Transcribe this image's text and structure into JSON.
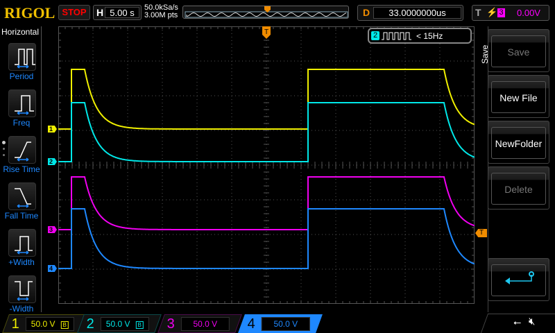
{
  "header": {
    "logo": "RIGOL",
    "run_state": "STOP",
    "timebase_label": "H",
    "timebase": "5.00 s",
    "sample_rate": "50.0kSa/s",
    "memory_depth": "3.00M pts",
    "delay_label": "D",
    "delay": "33.0000000us",
    "trigger_label": "T",
    "trigger_edge": "rising-edge-icon",
    "trigger_source": "3",
    "trigger_level": "0.00V"
  },
  "left_menu": {
    "title": "Horizontal",
    "items": [
      {
        "label": "Period",
        "icon": "period-icon"
      },
      {
        "label": "Freq",
        "icon": "frequency-icon"
      },
      {
        "label": "Rise Time",
        "icon": "rise-time-icon"
      },
      {
        "label": "Fall Time",
        "icon": "fall-time-icon"
      },
      {
        "label": "+Width",
        "icon": "positive-width-icon"
      },
      {
        "label": "-Width",
        "icon": "negative-width-icon"
      }
    ]
  },
  "measurement": {
    "channel": "2",
    "value": "< 15Hz"
  },
  "right_menu": {
    "title": "Save",
    "items": [
      {
        "label": "Save",
        "enabled": false
      },
      {
        "label": "New File",
        "enabled": true
      },
      {
        "label": "NewFolder",
        "enabled": true
      },
      {
        "label": "Delete",
        "enabled": false
      }
    ],
    "back_icon": "return-icon"
  },
  "channels": [
    {
      "num": "1",
      "scale": "50.0 V",
      "color": "#f0f000",
      "bw_limit": true
    },
    {
      "num": "2",
      "scale": "50.0 V",
      "color": "#00e8e8",
      "bw_limit": true
    },
    {
      "num": "3",
      "scale": "50.0 V",
      "color": "#f000f0",
      "bw_limit": false
    },
    {
      "num": "4",
      "scale": "50.0 V",
      "color": "#1e88ff",
      "bw_limit": false,
      "selected": true
    }
  ],
  "trigger_marker": "T",
  "status_icons": [
    "usb-icon",
    "sound-muted-icon"
  ]
}
